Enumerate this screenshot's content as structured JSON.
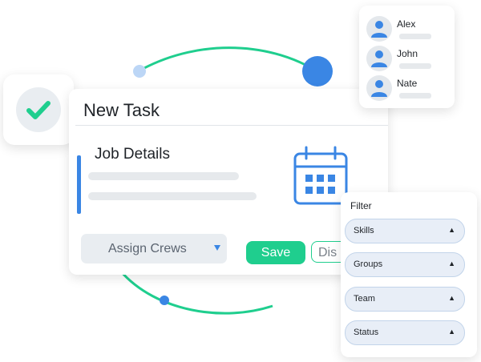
{
  "colors": {
    "accent_green": "#1fce8e",
    "accent_blue": "#3a86e4",
    "placeholder_gray": "#e6e9ec"
  },
  "check_badge": {
    "icon": "checkmark-icon"
  },
  "task": {
    "title": "New Task",
    "section_title": "Job Details",
    "calendar_icon": "calendar-icon",
    "assign_select": {
      "value": "Assign Crews",
      "icon": "chevron-down-icon"
    },
    "save_label": "Save",
    "discard_label": "Dis"
  },
  "people": [
    {
      "name": "Alex",
      "icon": "user-icon"
    },
    {
      "name": "John",
      "icon": "user-icon"
    },
    {
      "name": "Nate",
      "icon": "user-icon"
    }
  ],
  "filter": {
    "title": "Filter",
    "items": [
      {
        "label": "Skills",
        "icon": "chevron-up-icon"
      },
      {
        "label": "Groups",
        "icon": "chevron-up-icon"
      },
      {
        "label": "Team",
        "icon": "chevron-up-icon"
      },
      {
        "label": "Status",
        "icon": "chevron-up-icon"
      }
    ]
  }
}
